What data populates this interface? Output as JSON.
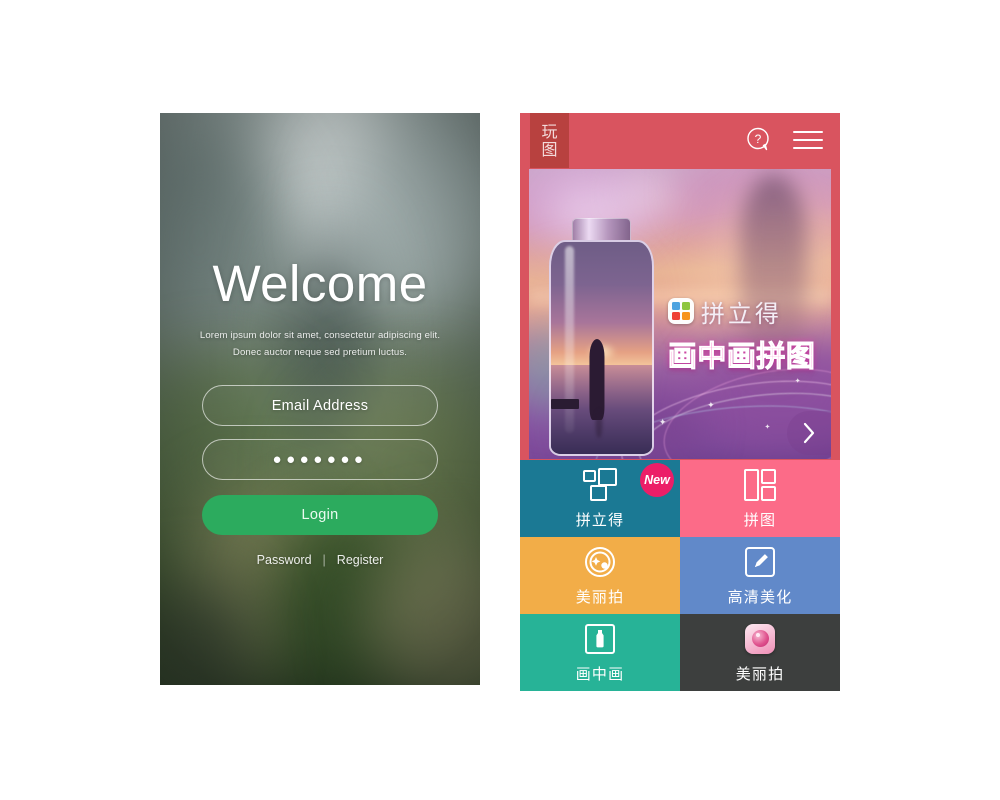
{
  "login": {
    "title": "Welcome",
    "subtitle_line1": "Lorem ipsum dolor sit amet, consectetur adipiscing elit.",
    "subtitle_line2": "Donec auctor neque sed pretium luctus.",
    "email_placeholder": "Email Address",
    "email_value": "Email Address",
    "password_mask": "●●●●●●●",
    "login_label": "Login",
    "password_link": "Password",
    "link_separator": "|",
    "register_link": "Register",
    "accent_color": "#2cab5e"
  },
  "app": {
    "header": {
      "logo_char_1": "玩",
      "logo_char_2": "图",
      "help_icon": "help-question-bubble-icon",
      "menu_icon": "hamburger-menu-icon",
      "bar_color": "#d9545f",
      "logo_bg_color": "#b8413f"
    },
    "banner": {
      "app_icon": "pinlide-app-icon",
      "title": "拼立得",
      "subtitle": "画中画拼图",
      "next_icon": "chevron-right-icon",
      "icon_tile_colors": [
        "#4da3e0",
        "#8ec63f",
        "#ef4136",
        "#f7941e"
      ],
      "subtitle_color": "#ff3fb0"
    },
    "tiles": [
      {
        "label": "拼立得",
        "icon": "three-squares-collage-icon",
        "bg": "#1b7994",
        "badge": "New",
        "badge_color": "#ec1e68"
      },
      {
        "label": "拼图",
        "icon": "two-panel-layout-icon",
        "bg": "#fc6b88",
        "badge": "",
        "badge_color": ""
      },
      {
        "label": "美丽拍",
        "icon": "camera-lens-sparkle-icon",
        "bg": "#f2ad48",
        "badge": "",
        "badge_color": ""
      },
      {
        "label": "高清美化",
        "icon": "pencil-edit-square-icon",
        "bg": "#6189c9",
        "badge": "",
        "badge_color": ""
      },
      {
        "label": "画中画",
        "icon": "bottle-in-frame-icon",
        "bg": "#27b397",
        "badge": "",
        "badge_color": ""
      },
      {
        "label": "美丽拍",
        "icon": "beauty-camera-app-icon",
        "bg": "#3d3f3e",
        "badge": "",
        "badge_color": ""
      }
    ]
  }
}
